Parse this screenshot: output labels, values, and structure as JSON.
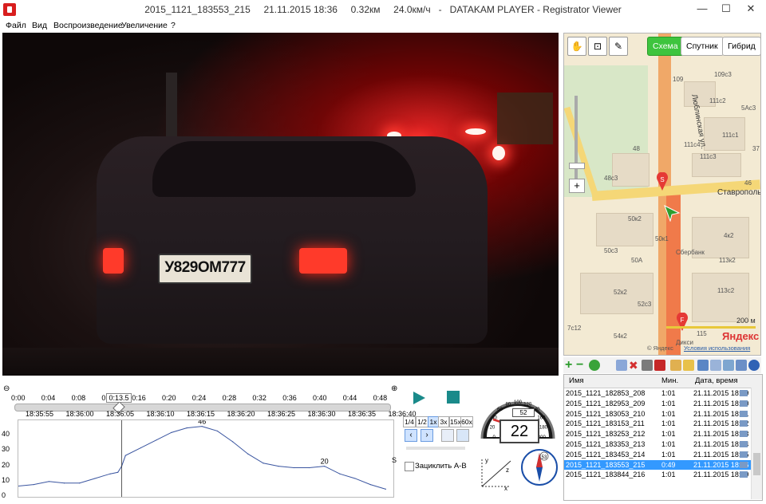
{
  "window": {
    "title": "2015_1121_183553_215     21.11.2015 18:36     0.32км     24.0км/ч   -   DATAKAM PLAYER - Registrator Viewer",
    "minimize": "—",
    "maximize": "☐",
    "close": "✕"
  },
  "menu": [
    "Файл",
    "Вид",
    "Воспроизведение",
    "Увеличение",
    "?"
  ],
  "video": {
    "plate": "У829ОМ777"
  },
  "map": {
    "tools": [
      "hand-icon",
      "zoom-rect-icon",
      "ruler-icon"
    ],
    "types": [
      "Схема",
      "Спутник",
      "Гибрид"
    ],
    "active_type": "Схема",
    "street_main": "Люблинская ул.",
    "street_cross": "Ставрополь",
    "labels": [
      "109",
      "109с3",
      "111с2",
      "5Ас3",
      "111с1",
      "111с4",
      "111с3",
      "48",
      "48с3",
      "50к2",
      "4к2",
      "50к1",
      "113к2",
      "50с3",
      "50А",
      "52к2",
      "52с3",
      "54к2",
      "115",
      "113с2",
      "46",
      "37",
      "7с12",
      "Сбербанк",
      "Дикси"
    ],
    "scale": "200 м",
    "brand": "Яндекс",
    "copyright": "© Яндекс",
    "terms": "Условия использования"
  },
  "files": {
    "columns": [
      "Имя",
      "Мин.",
      "Дата, время"
    ],
    "rows": [
      {
        "name": "2015_1121_182853_208",
        "min": "1:01",
        "date": "21.11.2015 18:29"
      },
      {
        "name": "2015_1121_182953_209",
        "min": "1:01",
        "date": "21.11.2015 18:30"
      },
      {
        "name": "2015_1121_183053_210",
        "min": "1:01",
        "date": "21.11.2015 18:31"
      },
      {
        "name": "2015_1121_183153_211",
        "min": "1:01",
        "date": "21.11.2015 18:32"
      },
      {
        "name": "2015_1121_183253_212",
        "min": "1:01",
        "date": "21.11.2015 18:33"
      },
      {
        "name": "2015_1121_183353_213",
        "min": "1:01",
        "date": "21.11.2015 18:34"
      },
      {
        "name": "2015_1121_183453_214",
        "min": "1:01",
        "date": "21.11.2015 18:35"
      },
      {
        "name": "2015_1121_183553_215",
        "min": "0:49",
        "date": "21.11.2015 18:36"
      },
      {
        "name": "2015_1121_183844_216",
        "min": "1:01",
        "date": "21.11.2015 18:39"
      }
    ],
    "selected_index": 7
  },
  "timeline": {
    "offsets": [
      "0:00",
      "0:04",
      "0:08",
      "0:12",
      "0:16",
      "0:20",
      "0:24",
      "0:28",
      "0:32",
      "0:36",
      "0:40",
      "0:44",
      "0:48"
    ],
    "clock": [
      "18:35:55",
      "18:36:00",
      "18:36:05",
      "18:36:10",
      "18:36:15",
      "18:36:20",
      "18:36:25",
      "18:36:30",
      "18:36:35",
      "18:36:40"
    ],
    "position": "0:13.5",
    "position_value": 13.5,
    "duration_value": 49
  },
  "chart_data": {
    "type": "line",
    "xlabel": "",
    "ylabel": "",
    "ylim": [
      0,
      50
    ],
    "yticks": [
      0,
      10,
      20,
      30,
      40
    ],
    "xlim": [
      0,
      49
    ],
    "cursor_x": 13.5,
    "series": [
      {
        "x": [
          0,
          2,
          4,
          6,
          8,
          10,
          12,
          13,
          13.5,
          14,
          16,
          18,
          20,
          22,
          24,
          26,
          28,
          30,
          32,
          34,
          36,
          38,
          40,
          42,
          44,
          46,
          48
        ],
        "y": [
          7,
          8,
          10,
          9,
          9,
          12,
          15,
          16,
          20,
          27,
          32,
          37,
          42,
          45,
          46,
          43,
          36,
          28,
          22,
          20,
          19,
          19,
          20,
          15,
          12,
          8,
          5
        ]
      }
    ],
    "annotations": [
      {
        "x": 24,
        "y": 46,
        "text": "46"
      },
      {
        "x": 40,
        "y": 20,
        "text": "20"
      }
    ],
    "unit_letter": "S"
  },
  "controls": {
    "rates": [
      "1/4",
      "1/2",
      "1x",
      "3x",
      "15x",
      "60x"
    ],
    "active_rate": "1x",
    "loop_label": "Зациклить А-В"
  },
  "gauge": {
    "speed": "22",
    "odometer": "52",
    "ticks": [
      "0",
      "20",
      "40",
      "60",
      "80",
      "100",
      "120",
      "140",
      "160",
      "180",
      "200"
    ],
    "compass_value": "53",
    "axes": [
      "x",
      "y",
      "z"
    ]
  }
}
